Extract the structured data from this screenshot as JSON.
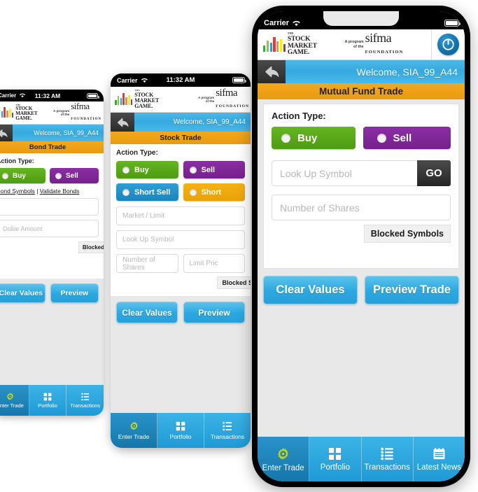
{
  "status_bar": {
    "carrier": "Carrier",
    "time": "11:32 AM",
    "wifi_icon": "wifi-icon",
    "battery_icon": "battery-full-icon"
  },
  "brand": {
    "smg_the": "THE",
    "smg_line1": "STOCK",
    "smg_line2": "MARKET",
    "smg_line3": "GAME.",
    "program_line1": "A program",
    "program_line2": "of the",
    "sifma_word": "sifma",
    "sifma_foundation": "FOUNDATION",
    "power_icon": "power-icon",
    "bar_colors": [
      "#3aa935",
      "#8dc63f",
      "#2b9fd6",
      "#e03a3e",
      "#f7941e",
      "#fff200",
      "#7e3f98"
    ]
  },
  "welcome": {
    "back_icon": "back-arrow-icon",
    "text": "Welcome, SIA_99_A44"
  },
  "screens": {
    "bond": {
      "page_title": "Bond Trade",
      "action_label": "Action Type:",
      "buttons": [
        {
          "label": "Buy",
          "color": "#4d9c12"
        },
        {
          "label": "Sell",
          "color": "#76208c"
        }
      ],
      "links": {
        "bond_symbols": "Bond Symbols",
        "separator": "|",
        "validate_bonds": "Validate Bonds"
      },
      "fields": [
        {
          "name": "symbol-field",
          "placeholder": ""
        },
        {
          "name": "dollar-amount-field",
          "placeholder": "Dollar Amount"
        }
      ],
      "blocked_label": "Blocked",
      "actions": [
        "Clear Values",
        "Preview"
      ],
      "tabs": [
        {
          "label": "Enter Trade",
          "icon": "gear-icon",
          "active": true
        },
        {
          "label": "Portfolio",
          "icon": "grid-icon",
          "active": false
        },
        {
          "label": "Transactions",
          "icon": "list-icon",
          "active": false
        }
      ]
    },
    "stock": {
      "page_title": "Stock Trade",
      "action_label": "Action Type:",
      "buttons": [
        {
          "label": "Buy",
          "color": "#4d9c12"
        },
        {
          "label": "Sell",
          "color": "#76208c"
        },
        {
          "label": "Short Sell",
          "color": "#1c84bd"
        },
        {
          "label": "Short",
          "color": "#e9a206"
        }
      ],
      "fields": [
        {
          "name": "market-limit-field",
          "placeholder": "Market / Limit"
        },
        {
          "name": "look-up-symbol-field",
          "placeholder": "Look Up Symbol"
        },
        {
          "name": "number-of-shares-field",
          "placeholder": "Number of Shares"
        },
        {
          "name": "limit-price-field",
          "placeholder": "Limit Pric"
        }
      ],
      "blocked_label": "Blocked S",
      "actions": [
        "Clear Values",
        "Preview"
      ],
      "tabs": [
        {
          "label": "Enter Trade",
          "icon": "gear-icon",
          "active": true
        },
        {
          "label": "Portfolio",
          "icon": "grid-icon",
          "active": false
        },
        {
          "label": "Transactions",
          "icon": "list-icon",
          "active": false
        }
      ]
    },
    "mutual_fund": {
      "page_title": "Mutual Fund Trade",
      "action_label": "Action Type:",
      "buttons": [
        {
          "label": "Buy",
          "color": "#4d9c12"
        },
        {
          "label": "Sell",
          "color": "#76208c"
        }
      ],
      "fields": [
        {
          "name": "look-up-symbol-field",
          "placeholder": "Look Up Symbol"
        },
        {
          "name": "number-of-shares-field",
          "placeholder": "Number of Shares"
        }
      ],
      "go_label": "GO",
      "blocked_label": "Blocked Symbols",
      "actions": [
        "Clear Values",
        "Preview Trade"
      ],
      "tabs": [
        {
          "label": "Enter Trade",
          "icon": "gear-icon",
          "active": true
        },
        {
          "label": "Portfolio",
          "icon": "grid-icon",
          "active": false
        },
        {
          "label": "Transactions",
          "icon": "list-icon",
          "active": false
        },
        {
          "label": "Latest News",
          "icon": "news-icon",
          "active": false
        }
      ]
    }
  },
  "colors": {
    "orange_bar": "#eda113",
    "welcome_blue": "#38abe1",
    "button_blue": "#2ca8e0",
    "tab_blue": "#2aa9e0",
    "tab_active": "#1577ab",
    "screen_bg": "#e8e8e8"
  }
}
